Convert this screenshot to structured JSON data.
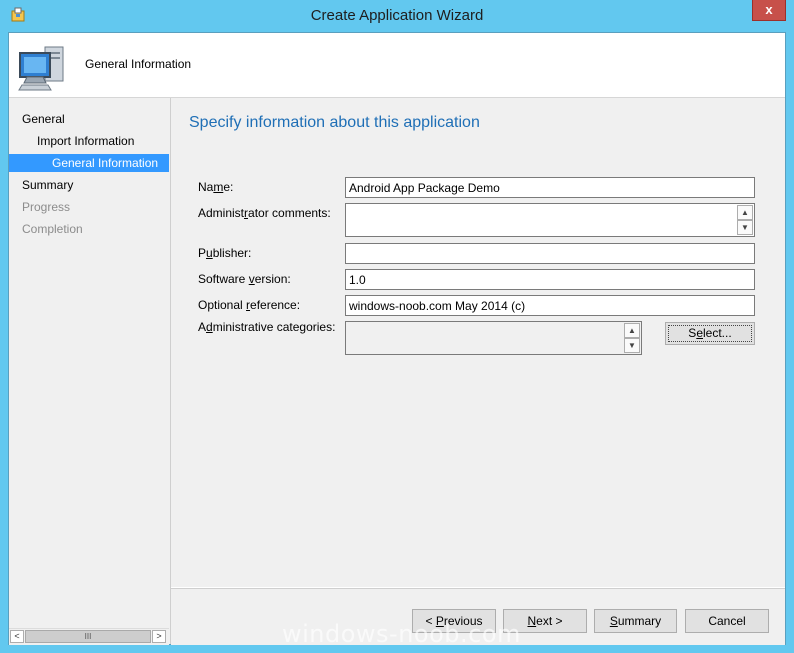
{
  "window": {
    "title": "Create Application Wizard",
    "close_glyph": "x",
    "accent_color": "#62c8ef"
  },
  "header": {
    "title": "General Information",
    "icon": "computer-icon"
  },
  "nav": {
    "items": [
      {
        "label": "General",
        "state": "normal"
      },
      {
        "label": "Import Information",
        "state": "normal"
      },
      {
        "label": "General Information",
        "state": "selected"
      },
      {
        "label": "Summary",
        "state": "normal"
      },
      {
        "label": "Progress",
        "state": "disabled"
      },
      {
        "label": "Completion",
        "state": "disabled"
      }
    ],
    "scroll_left": "<",
    "scroll_thumb": "III",
    "scroll_right": ">"
  },
  "page": {
    "heading": "Specify information about this application"
  },
  "form": {
    "name": {
      "label_pre": "Na",
      "label_key": "m",
      "label_post": "e:",
      "value": "Android App Package Demo"
    },
    "admin_comments": {
      "label_pre": "Administ",
      "label_key": "r",
      "label_post": "ator comments:",
      "value": ""
    },
    "publisher": {
      "label_pre": "P",
      "label_key": "u",
      "label_post": "blisher:",
      "value": ""
    },
    "software_version": {
      "label_pre": "Software ",
      "label_key": "v",
      "label_post": "ersion:",
      "value": "1.0"
    },
    "optional_reference": {
      "label_pre": "Optional ",
      "label_key": "r",
      "label_post": "eference:",
      "value": "windows-noob.com May 2014 (c)"
    },
    "admin_categories": {
      "label_pre": "A",
      "label_key": "d",
      "label_post": "ministrative categories:"
    },
    "select_button": {
      "pre": "S",
      "key": "e",
      "post": "lect..."
    }
  },
  "scroll_up": "▲",
  "scroll_down": "▼",
  "buttons": {
    "previous": {
      "pre": "< ",
      "key": "P",
      "post": "revious"
    },
    "next": {
      "pre": "",
      "key": "N",
      "post": "ext >"
    },
    "summary": {
      "pre": "",
      "key": "S",
      "post": "ummary"
    },
    "cancel": {
      "label": "Cancel"
    }
  },
  "watermark": "windows-noob.com"
}
